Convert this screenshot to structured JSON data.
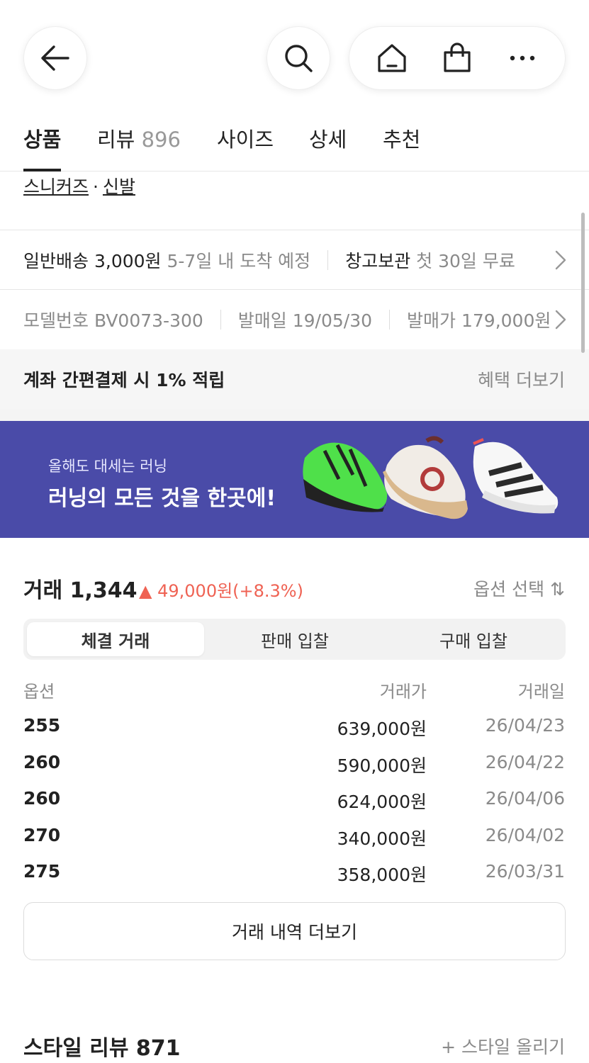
{
  "nav": {
    "back_icon": "arrow-left-icon",
    "search_icon": "search-icon",
    "home_icon": "home-icon",
    "bag_icon": "shopping-bag-icon",
    "more_icon": "more-dots-icon"
  },
  "tabs": [
    {
      "label": "상품",
      "count": "",
      "active": true
    },
    {
      "label": "리뷰",
      "count": "896",
      "active": false
    },
    {
      "label": "사이즈",
      "count": "",
      "active": false
    },
    {
      "label": "상세",
      "count": "",
      "active": false
    },
    {
      "label": "추천",
      "count": "",
      "active": false
    }
  ],
  "category": {
    "first": "스니커즈",
    "separator": "·",
    "second": "신발"
  },
  "shipping": {
    "method": "일반배송",
    "fee": "3,000원",
    "eta": "5-7일 내 도착 예정",
    "storage_label": "창고보관",
    "storage_note": "첫 30일 무료"
  },
  "model": {
    "model_no": "모델번호 BV0073-300",
    "release_date": "발매일 19/05/30",
    "release_price": "발매가 179,000원"
  },
  "benefit": {
    "text": "계좌 간편결제 시 1% 적립",
    "more": "혜택 더보기"
  },
  "banner": {
    "subtitle": "올해도 대세는 러닝",
    "title": "러닝의 모든 것을 한곳에!",
    "accent_color": "#4a4ba8"
  },
  "trade": {
    "title": "거래 1,344",
    "change_arrow": "▲",
    "change": "49,000원(+8.3%)",
    "change_color": "#ef6253",
    "option_select": "옵션 선택 ⇅",
    "segments": [
      "체결 거래",
      "판매 입찰",
      "구매 입찰"
    ],
    "headers": {
      "option": "옵션",
      "price": "거래가",
      "date": "거래일"
    },
    "rows": [
      {
        "option": "255",
        "price": "639,000원",
        "date": "26/04/23"
      },
      {
        "option": "260",
        "price": "590,000원",
        "date": "26/04/22"
      },
      {
        "option": "260",
        "price": "624,000원",
        "date": "26/04/06"
      },
      {
        "option": "270",
        "price": "340,000원",
        "date": "26/04/02"
      },
      {
        "option": "275",
        "price": "358,000원",
        "date": "26/03/31"
      }
    ],
    "more": "거래 내역 더보기"
  },
  "style_review": {
    "title": "스타일 리뷰 871",
    "upload": "+ 스타일 올리기"
  }
}
